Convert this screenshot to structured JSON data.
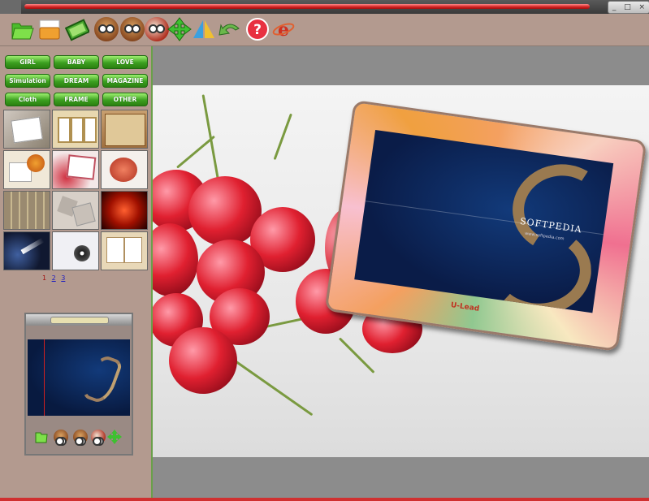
{
  "window": {
    "controls": [
      "_",
      "□",
      "×"
    ]
  },
  "toolbar": {
    "icons": [
      "folder-open-icon",
      "image-folder-icon",
      "photo-icon",
      "owl-icon",
      "owl-icon",
      "owl-frame-icon",
      "move-arrows-icon",
      "flip-icon",
      "undo-icon",
      "help-icon",
      "ie-browser-icon"
    ]
  },
  "categories": [
    "GIRL",
    "BABY",
    "LOVE",
    "Simulation",
    "DREAM",
    "MAGAZINE",
    "Cloth",
    "FRAME",
    "OTHER"
  ],
  "pager": {
    "pages": [
      "1",
      "2",
      "3"
    ],
    "current": "1"
  },
  "photo": {
    "watermark": "SOFTPEDIA",
    "subtitle": "www.softpedia.com",
    "frame_logo": "U-Lead"
  },
  "colors": {
    "panel": "#b39a8f",
    "category_green": "#3ca020",
    "canvas_gray": "#8c8c8c",
    "title_red": "#d02020"
  }
}
